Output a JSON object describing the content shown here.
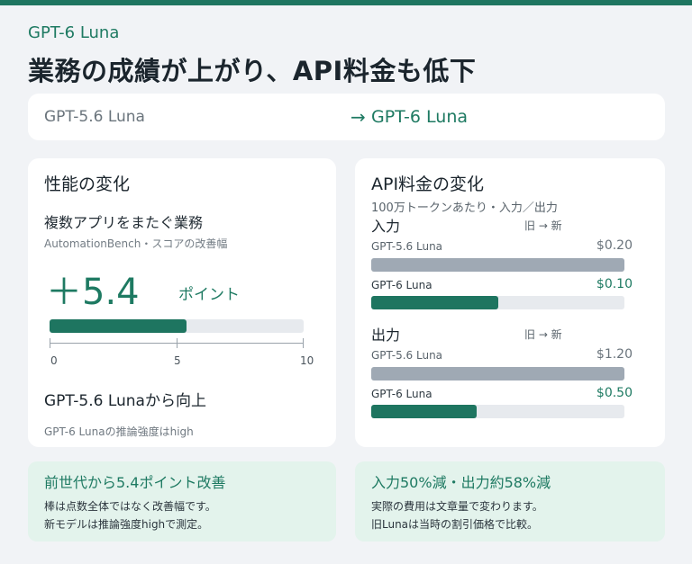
{
  "header": {
    "eyebrow": "GPT-6 Luna",
    "headline": "業務の成績が上がり、API料金も低下"
  },
  "comparison": {
    "old_model": "GPT-5.6 Luna",
    "arrow": "→",
    "new_model": "GPT-6 Luna"
  },
  "performance": {
    "title": "性能の変化",
    "task": "複数アプリをまたぐ業務",
    "metric_note": "AutomationBench・スコアの改善幅",
    "big_value": "＋5.4",
    "unit": "ポイント",
    "improvement": 5.4,
    "scale_max": 10,
    "ticks": [
      "0",
      "5",
      "10"
    ],
    "claim": "GPT-5.6 Lunaから向上",
    "footnote": "GPT-6 Lunaの推論強度はhigh"
  },
  "pricing": {
    "title": "API料金の変化",
    "subtitle": "100万トークンあたり・入力／出力",
    "sections": [
      {
        "label": "入力",
        "legend": "旧 → 新",
        "rows": [
          {
            "model": "GPT-5.6 Luna",
            "price_text": "$0.20",
            "price": 0.2
          },
          {
            "model": "GPT-6 Luna",
            "price_text": "$0.10",
            "price": 0.1
          }
        ]
      },
      {
        "label": "出力",
        "legend": "旧 → 新",
        "rows": [
          {
            "model": "GPT-5.6 Luna",
            "price_text": "$1.20",
            "price": 1.2
          },
          {
            "model": "GPT-6 Luna",
            "price_text": "$0.50",
            "price": 0.5
          }
        ]
      }
    ]
  },
  "callouts": {
    "left": {
      "title": "前世代から5.4ポイント改善",
      "lines": [
        "棒は点数全体ではなく改善幅です。",
        "新モデルは推論強度highで測定。"
      ]
    },
    "right": {
      "title": "入力50%減・出力約58%減",
      "lines": [
        "実際の費用は文章量で変わります。",
        "旧Lunaは当時の割引価格で比較。"
      ]
    }
  },
  "colors": {
    "accent": "#1e7a62",
    "bar_new": "#1e7560",
    "bar_old": "#9fa9b4",
    "track": "#e7eaee",
    "callout_bg": "#e3f3ec",
    "page_bg": "#f1f3f6"
  }
}
